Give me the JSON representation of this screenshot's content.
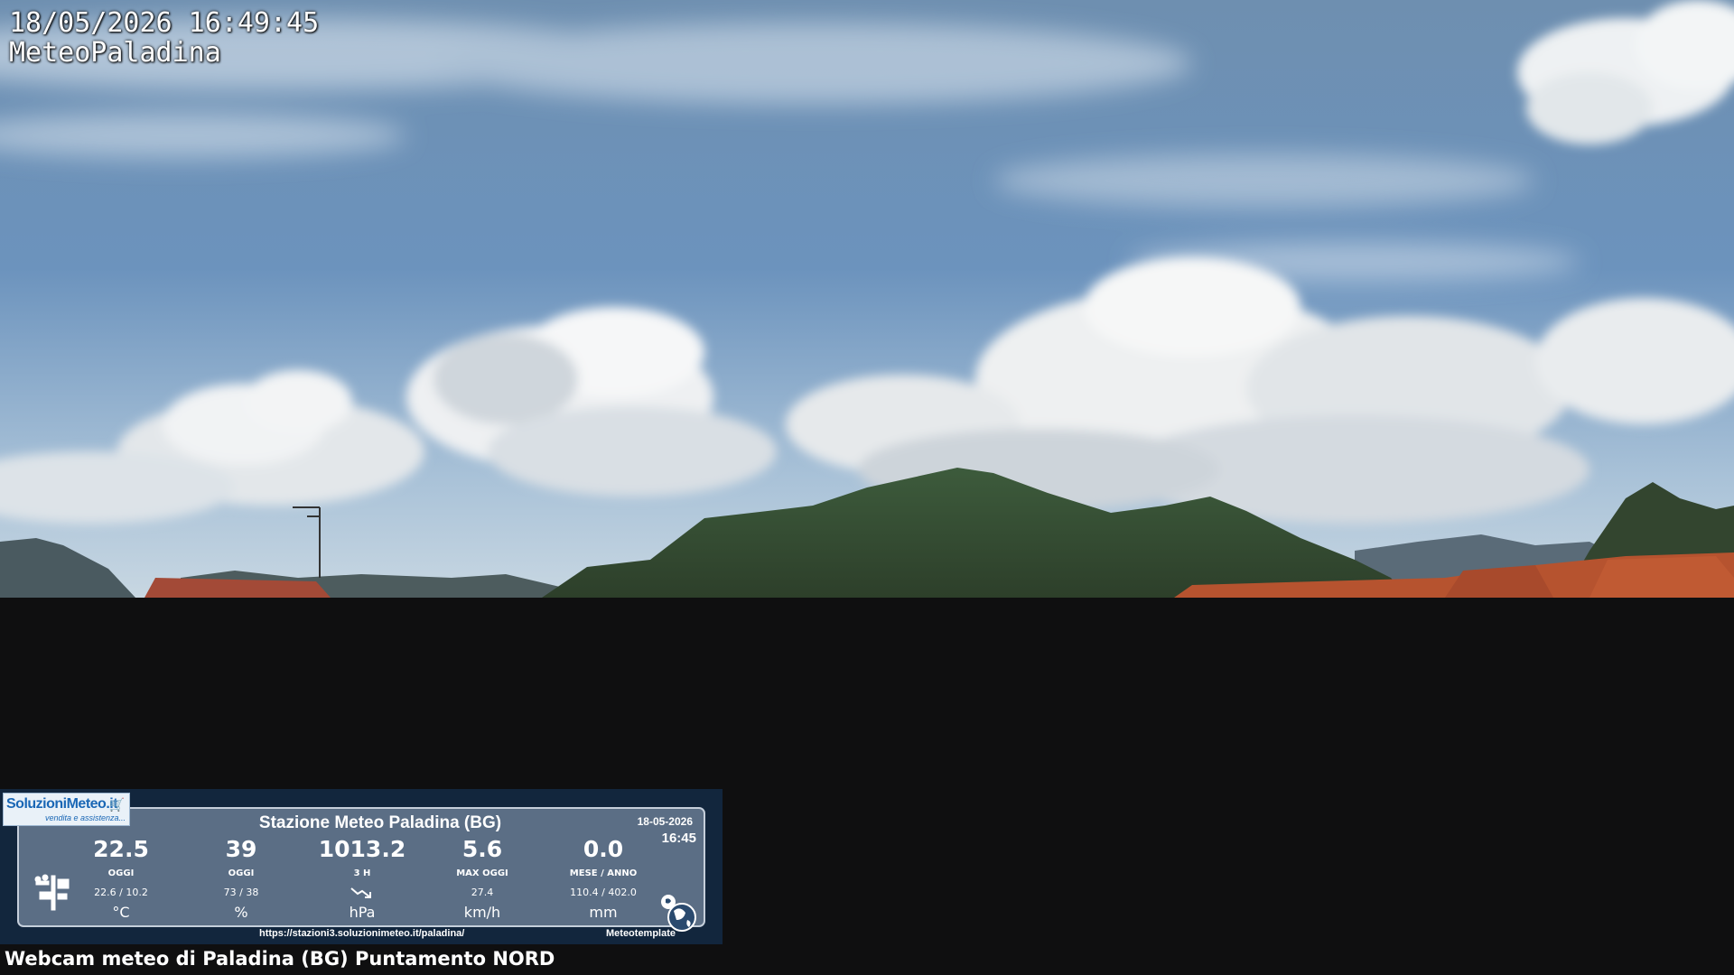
{
  "overlay": {
    "timestamp": "18/05/2026 16:49:45",
    "brand": "MeteoPaladina"
  },
  "logo": {
    "name": "SoluzioniMeteo.it",
    "tagline": "vendita e assistenza..."
  },
  "station": {
    "title": "Stazione Meteo Paladina (BG)",
    "date": "18-05-2026",
    "time": "16:45",
    "readings": [
      {
        "value": "22.5",
        "sublabel": "OGGI",
        "minmax": "22.6 / 10.2",
        "unit": "°C"
      },
      {
        "value": "39",
        "sublabel": "OGGI",
        "minmax": "73 / 38",
        "unit": "%"
      },
      {
        "value": "1013.2",
        "sublabel": "3 H",
        "minmax": "",
        "unit": "hPa"
      },
      {
        "value": "5.6",
        "sublabel": "MAX OGGI",
        "minmax": "27.4",
        "unit": "km/h"
      },
      {
        "value": "0.0",
        "sublabel": "MESE / ANNO",
        "minmax": "110.4 / 402.0",
        "unit": "mm"
      }
    ],
    "url": "https://stazioni3.soluzionimeteo.it/paladina/",
    "template": "Meteotemplate"
  },
  "caption": "Webcam meteo di Paladina (BG) Puntamento NORD",
  "colors": {
    "sky_top": "#5b82a8",
    "sky_bottom": "#b9cfe0",
    "mountain": "#3f5a3a",
    "roof": "#b54a32",
    "panel_bg": "#12263d",
    "card_bg": "#5b6e85"
  }
}
